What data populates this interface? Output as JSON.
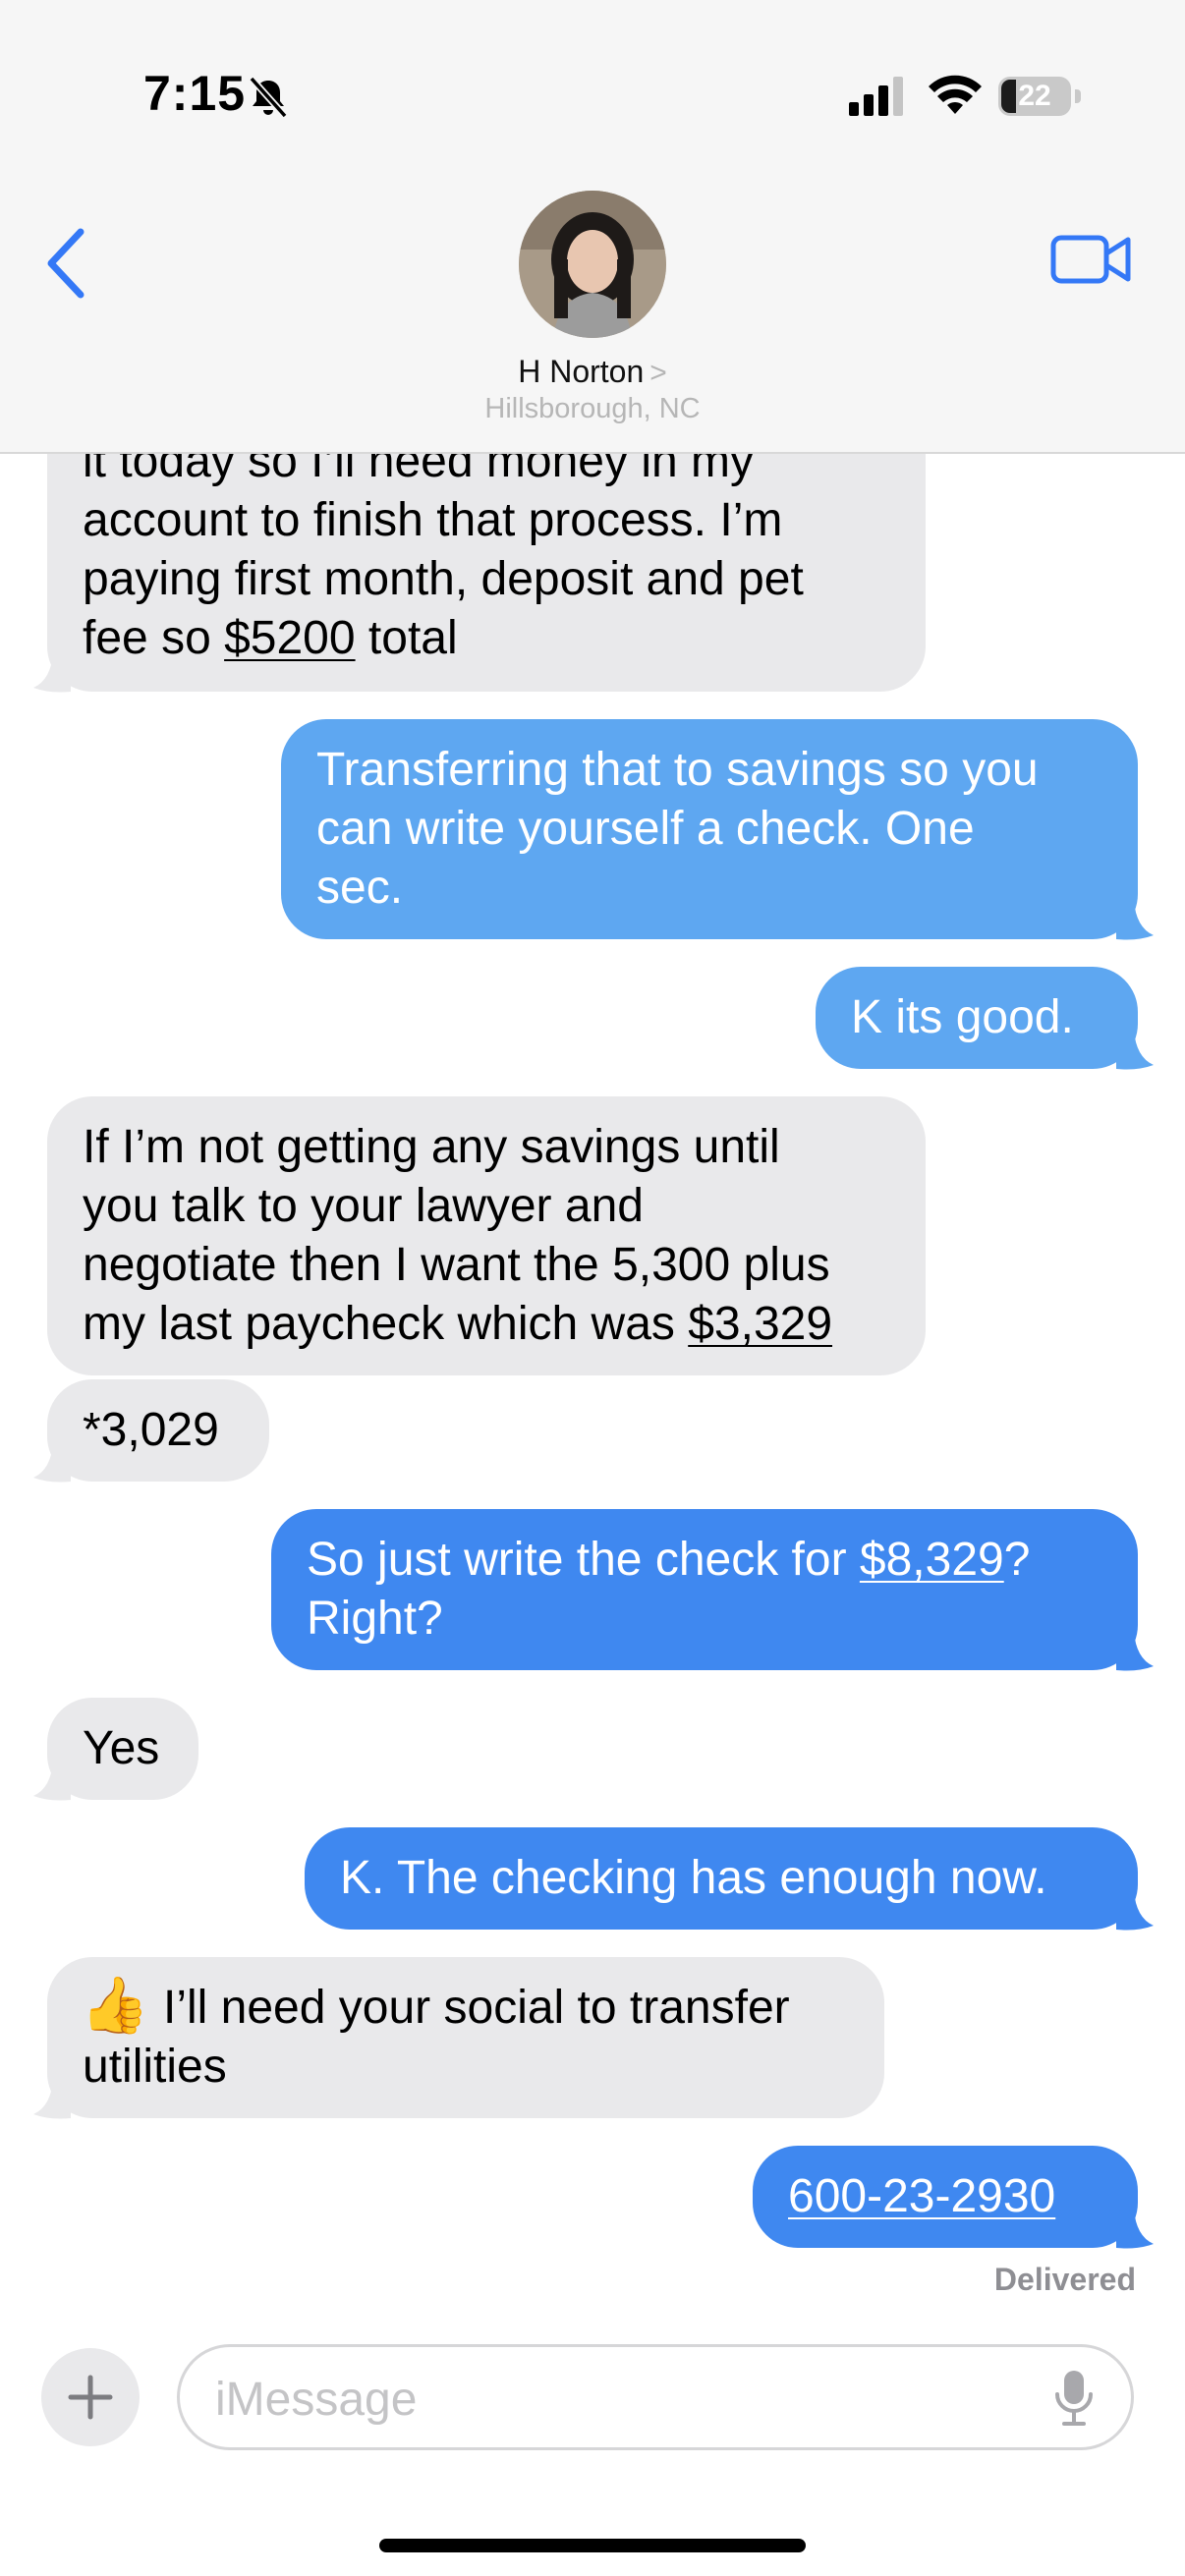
{
  "status_bar": {
    "time": "7:15",
    "battery_percent": "22",
    "battery_level": 0.22
  },
  "header": {
    "back_icon": "chevron-left-icon",
    "contact_name": "H Norton",
    "name_chevron": ">",
    "location": "Hillsborough, NC",
    "video_icon": "video-camera-icon"
  },
  "messages": [
    {
      "side": "in",
      "lines": [
        "it today so I’ll need money in my",
        "account to finish that process. I’m",
        "paying first month, deposit and pet"
      ],
      "last_prefix": "fee so ",
      "last_link": "$5200",
      "last_suffix": " total"
    },
    {
      "side": "out",
      "lines": [
        "Transferring that to savings so you",
        "can write yourself a check. One",
        "sec."
      ]
    },
    {
      "side": "out",
      "text": "K its good."
    },
    {
      "side": "in",
      "lines": [
        "If I’m not getting any savings until",
        "you talk to your lawyer and",
        "negotiate then I want the 5,300 plus"
      ],
      "last_prefix": "my last paycheck which was ",
      "last_link": "$3,329"
    },
    {
      "side": "in",
      "text": "*3,029"
    },
    {
      "side": "out",
      "line1_prefix": "So just write the check for ",
      "line1_link": "$8,329",
      "line1_suffix": "?",
      "line2": "Right?"
    },
    {
      "side": "in",
      "text": "Yes"
    },
    {
      "side": "out",
      "text": "K. The checking has enough now."
    },
    {
      "side": "in",
      "line1": "I’ll need your social to transfer",
      "line2": "utilities",
      "emoji": "👍"
    },
    {
      "side": "out",
      "link": "600-23-2930"
    }
  ],
  "delivered_label": "Delivered",
  "composer": {
    "plus_icon": "plus-icon",
    "placeholder": "iMessage",
    "mic_icon": "microphone-icon"
  },
  "colors": {
    "incoming_bubble": "#e9e9eb",
    "outgoing_bubble_light": "#5ea7f1",
    "outgoing_bubble": "#3f88f0",
    "accent": "#3478f6",
    "header_bg": "#f6f6f6"
  }
}
